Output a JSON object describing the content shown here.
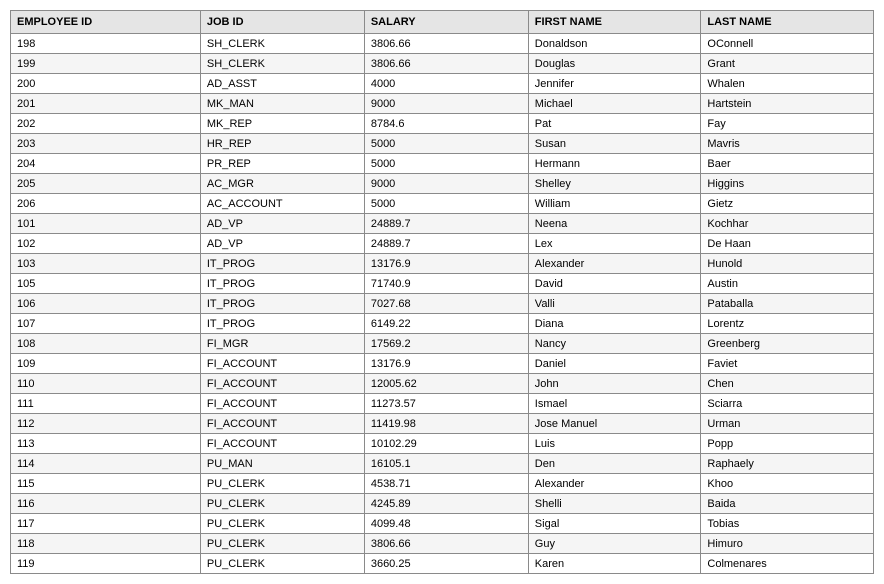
{
  "table": {
    "headers": [
      "EMPLOYEE ID",
      "JOB ID",
      "SALARY",
      "FIRST NAME",
      "LAST NAME"
    ],
    "rows": [
      {
        "employee_id": "198",
        "job_id": "SH_CLERK",
        "salary": "3806.66",
        "first_name": "Donaldson",
        "last_name": "OConnell"
      },
      {
        "employee_id": "199",
        "job_id": "SH_CLERK",
        "salary": "3806.66",
        "first_name": "Douglas",
        "last_name": "Grant"
      },
      {
        "employee_id": "200",
        "job_id": "AD_ASST",
        "salary": "4000",
        "first_name": "Jennifer",
        "last_name": "Whalen"
      },
      {
        "employee_id": "201",
        "job_id": "MK_MAN",
        "salary": "9000",
        "first_name": "Michael",
        "last_name": "Hartstein"
      },
      {
        "employee_id": "202",
        "job_id": "MK_REP",
        "salary": "8784.6",
        "first_name": "Pat",
        "last_name": "Fay"
      },
      {
        "employee_id": "203",
        "job_id": "HR_REP",
        "salary": "5000",
        "first_name": "Susan",
        "last_name": "Mavris"
      },
      {
        "employee_id": "204",
        "job_id": "PR_REP",
        "salary": "5000",
        "first_name": "Hermann",
        "last_name": "Baer"
      },
      {
        "employee_id": "205",
        "job_id": "AC_MGR",
        "salary": "9000",
        "first_name": "Shelley",
        "last_name": "Higgins"
      },
      {
        "employee_id": "206",
        "job_id": "AC_ACCOUNT",
        "salary": "5000",
        "first_name": "William",
        "last_name": "Gietz"
      },
      {
        "employee_id": "101",
        "job_id": "AD_VP",
        "salary": "24889.7",
        "first_name": "Neena",
        "last_name": "Kochhar"
      },
      {
        "employee_id": "102",
        "job_id": "AD_VP",
        "salary": "24889.7",
        "first_name": "Lex",
        "last_name": "De Haan"
      },
      {
        "employee_id": "103",
        "job_id": "IT_PROG",
        "salary": "13176.9",
        "first_name": "Alexander",
        "last_name": "Hunold"
      },
      {
        "employee_id": "105",
        "job_id": "IT_PROG",
        "salary": "71740.9",
        "first_name": "David",
        "last_name": "Austin"
      },
      {
        "employee_id": "106",
        "job_id": "IT_PROG",
        "salary": "7027.68",
        "first_name": "Valli",
        "last_name": "Pataballa"
      },
      {
        "employee_id": "107",
        "job_id": "IT_PROG",
        "salary": "6149.22",
        "first_name": "Diana",
        "last_name": "Lorentz"
      },
      {
        "employee_id": "108",
        "job_id": "FI_MGR",
        "salary": "17569.2",
        "first_name": "Nancy",
        "last_name": "Greenberg"
      },
      {
        "employee_id": "109",
        "job_id": "FI_ACCOUNT",
        "salary": "13176.9",
        "first_name": "Daniel",
        "last_name": "Faviet"
      },
      {
        "employee_id": "110",
        "job_id": "FI_ACCOUNT",
        "salary": "12005.62",
        "first_name": "John",
        "last_name": "Chen"
      },
      {
        "employee_id": "111",
        "job_id": "FI_ACCOUNT",
        "salary": "11273.57",
        "first_name": "Ismael",
        "last_name": "Sciarra"
      },
      {
        "employee_id": "112",
        "job_id": "FI_ACCOUNT",
        "salary": "11419.98",
        "first_name": "Jose Manuel",
        "last_name": "Urman"
      },
      {
        "employee_id": "113",
        "job_id": "FI_ACCOUNT",
        "salary": "10102.29",
        "first_name": "Luis",
        "last_name": "Popp"
      },
      {
        "employee_id": "114",
        "job_id": "PU_MAN",
        "salary": "16105.1",
        "first_name": "Den",
        "last_name": "Raphaely"
      },
      {
        "employee_id": "115",
        "job_id": "PU_CLERK",
        "salary": "4538.71",
        "first_name": "Alexander",
        "last_name": "Khoo"
      },
      {
        "employee_id": "116",
        "job_id": "PU_CLERK",
        "salary": "4245.89",
        "first_name": "Shelli",
        "last_name": "Baida"
      },
      {
        "employee_id": "117",
        "job_id": "PU_CLERK",
        "salary": "4099.48",
        "first_name": "Sigal",
        "last_name": "Tobias"
      },
      {
        "employee_id": "118",
        "job_id": "PU_CLERK",
        "salary": "3806.66",
        "first_name": "Guy",
        "last_name": "Himuro"
      },
      {
        "employee_id": "119",
        "job_id": "PU_CLERK",
        "salary": "3660.25",
        "first_name": "Karen",
        "last_name": "Colmenares"
      }
    ]
  }
}
